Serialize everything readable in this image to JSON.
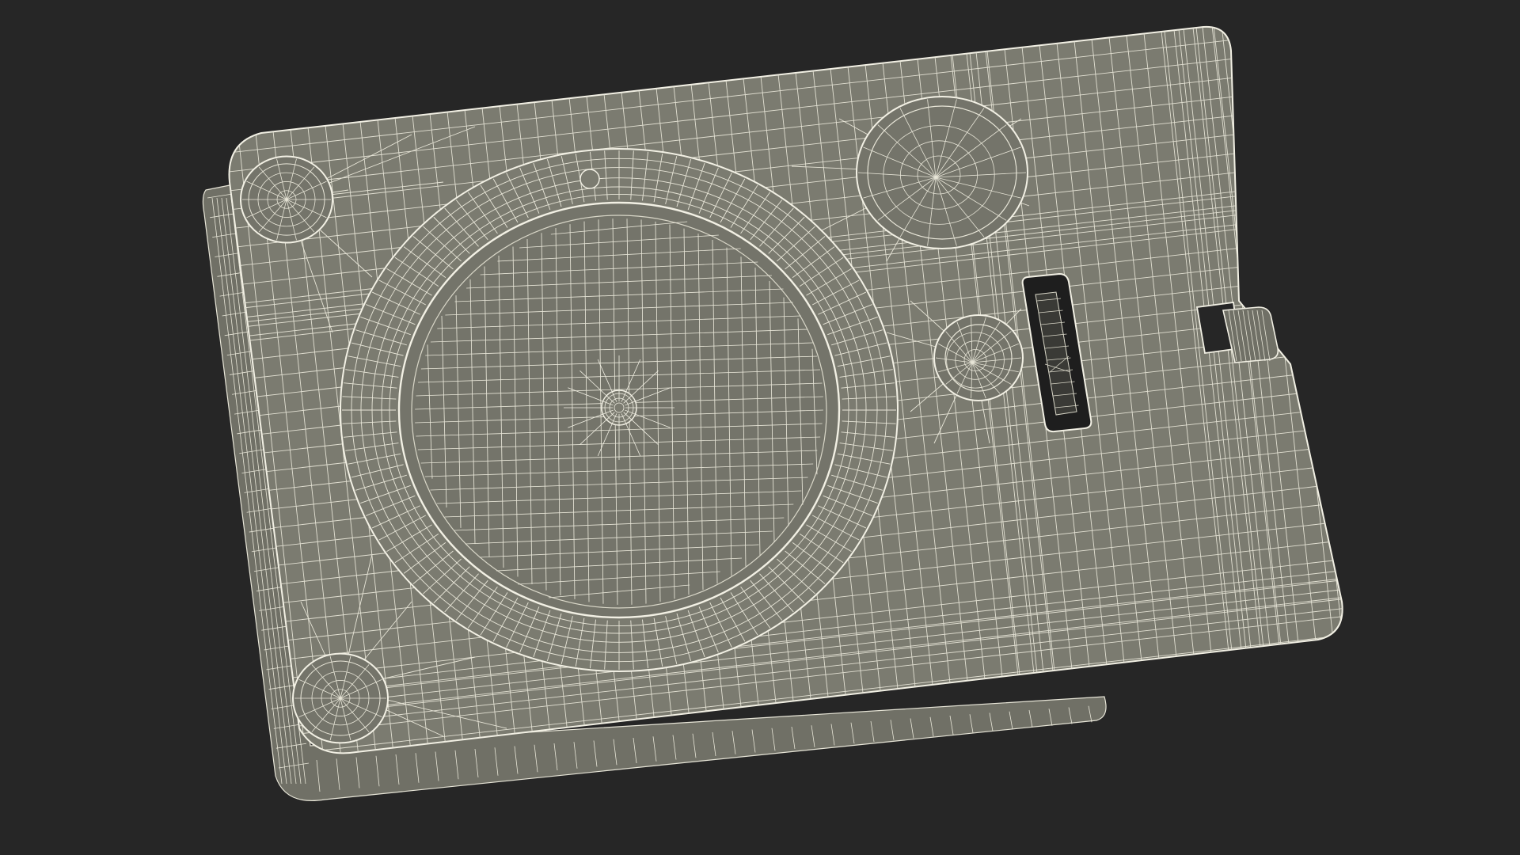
{
  "scene": {
    "subject": "wireframe-device-model",
    "colors": {
      "background": "#262626",
      "body_fill": "#7b7b70",
      "body_fill_dark": "#6c6c62",
      "side_fill": "#707066",
      "recess_fill": "#74746a",
      "wire": "#e8e6d8",
      "wire_dense": "#f2f0e4",
      "slot_dark": "#1e1e1e"
    }
  }
}
